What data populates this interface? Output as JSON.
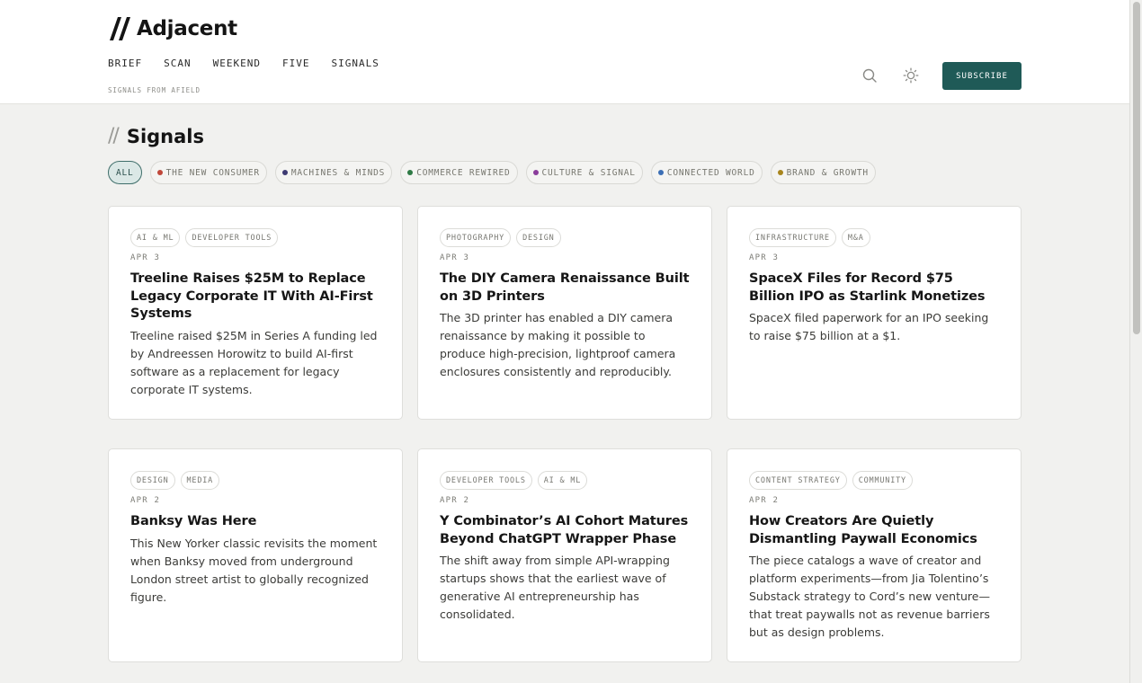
{
  "brand": {
    "name": "Adjacent",
    "tagline": "SIGNALS FROM AFIELD"
  },
  "nav": [
    "BRIEF",
    "SCAN",
    "WEEKEND",
    "FIVE",
    "SIGNALS"
  ],
  "header": {
    "search_icon": "search-icon",
    "theme_icon": "sun-icon",
    "subscribe_label": "SUBSCRIBE",
    "accent": "#1f5a57"
  },
  "section": {
    "slashes": "//",
    "title": "Signals"
  },
  "filters": [
    {
      "label": "ALL",
      "active": true,
      "color": ""
    },
    {
      "label": "THE NEW CONSUMER",
      "active": false,
      "color": "#c0473a"
    },
    {
      "label": "MACHINES & MINDS",
      "active": false,
      "color": "#3d3a72"
    },
    {
      "label": "COMMERCE REWIRED",
      "active": false,
      "color": "#2e7a45"
    },
    {
      "label": "CULTURE & SIGNAL",
      "active": false,
      "color": "#8a3d9b"
    },
    {
      "label": "CONNECTED WORLD",
      "active": false,
      "color": "#3b6fb5"
    },
    {
      "label": "BRAND & GROWTH",
      "active": false,
      "color": "#a8851d"
    }
  ],
  "cards": [
    {
      "tags": [
        "AI & ML",
        "DEVELOPER TOOLS"
      ],
      "date": "APR 3",
      "title": "Treeline Raises $25M to Replace Legacy Corporate IT With AI-First Systems",
      "summary": "Treeline raised $25M in Series A funding led by Andreessen Horowitz to build AI-first software as a replacement for legacy corporate IT systems."
    },
    {
      "tags": [
        "PHOTOGRAPHY",
        "DESIGN"
      ],
      "date": "APR 3",
      "title": "The DIY Camera Renaissance Built on 3D Printers",
      "summary": "The 3D printer has enabled a DIY camera renaissance by making it possible to produce high-precision, lightproof camera enclosures consistently and reproducibly."
    },
    {
      "tags": [
        "INFRASTRUCTURE",
        "M&A"
      ],
      "date": "APR 3",
      "title": "SpaceX Files for Record $75 Billion IPO as Starlink Monetizes",
      "summary": "SpaceX filed paperwork for an IPO seeking to raise $75 billion at a $1."
    },
    {
      "tags": [
        "DESIGN",
        "MEDIA"
      ],
      "date": "APR 2",
      "title": "Banksy Was Here",
      "summary": "This New Yorker classic revisits the moment when Banksy moved from underground London street artist to globally recognized figure."
    },
    {
      "tags": [
        "DEVELOPER TOOLS",
        "AI & ML"
      ],
      "date": "APR 2",
      "title": "Y Combinator’s AI Cohort Matures Beyond ChatGPT Wrapper Phase",
      "summary": "The shift away from simple API-wrapping startups shows that the earliest wave of generative AI entrepreneurship has consolidated."
    },
    {
      "tags": [
        "CONTENT STRATEGY",
        "COMMUNITY"
      ],
      "date": "APR 2",
      "title": "How Creators Are Quietly Dismantling Paywall Economics",
      "summary": "The piece catalogs a wave of creator and platform experiments—from Jia Tolentino’s Substack strategy to Cord’s new venture—that treat paywalls not as revenue barriers but as design problems."
    }
  ]
}
